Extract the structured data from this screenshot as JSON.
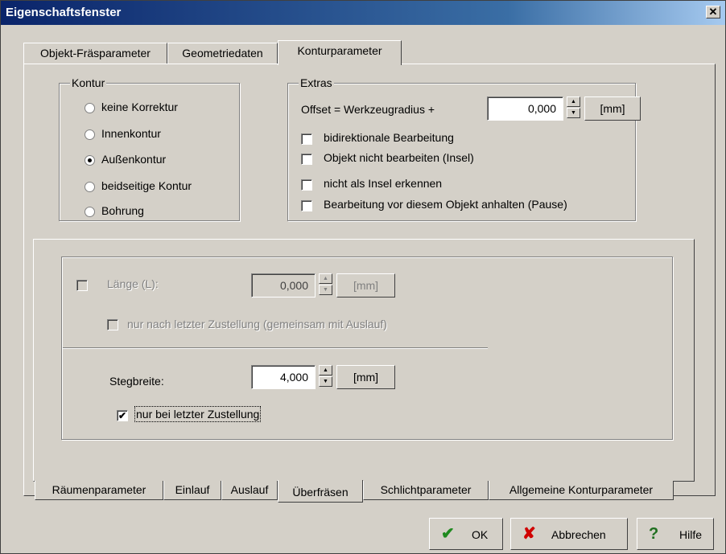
{
  "window": {
    "title": "Eigenschaftsfenster",
    "close_glyph": "✕"
  },
  "top_tabs": [
    {
      "label": "Objekt-Fräsparameter"
    },
    {
      "label": "Geometriedaten"
    },
    {
      "label": "Konturparameter",
      "active": true
    }
  ],
  "kontur": {
    "legend": "Kontur",
    "options": [
      {
        "label": "keine Korrektur",
        "checked": false
      },
      {
        "label": "Innenkontur",
        "checked": false
      },
      {
        "label": "Außenkontur",
        "checked": true
      },
      {
        "label": "beidseitige Kontur",
        "checked": false
      },
      {
        "label": "Bohrung",
        "checked": false
      }
    ]
  },
  "extras": {
    "legend": "Extras",
    "offset_label": "Offset = Werkzeugradius +",
    "offset_value": "0,000",
    "unit": "[mm]",
    "checks": [
      {
        "label": "bidirektionale Bearbeitung",
        "checked": false
      },
      {
        "label": "Objekt nicht bearbeiten (Insel)",
        "checked": false
      },
      {
        "label": "nicht als Insel erkennen",
        "checked": false
      },
      {
        "label": "Bearbeitung vor diesem Objekt anhalten (Pause)",
        "checked": false
      }
    ]
  },
  "ueberfraesen": {
    "laenge_label": "Länge (L):",
    "laenge_value": "0,000",
    "laenge_unit": "[mm]",
    "nur_nach_label": "nur nach letzter Zustellung (gemeinsam mit Auslauf)",
    "stegbreite_label": "Stegbreite:",
    "stegbreite_value": "4,000",
    "stegbreite_unit": "[mm]",
    "nur_bei_label": "nur bei letzter Zustellung",
    "nur_bei_checked": true,
    "check_glyph": "✔"
  },
  "bottom_tabs": [
    {
      "label": "Räumenparameter"
    },
    {
      "label": "Einlauf"
    },
    {
      "label": "Auslauf"
    },
    {
      "label": "Überfräsen",
      "active": true
    },
    {
      "label": "Schlichtparameter"
    },
    {
      "label": "Allgemeine Konturparameter"
    }
  ],
  "buttons": {
    "ok": "OK",
    "ok_icon": "✔",
    "cancel": "Abbrechen",
    "cancel_icon": "✘",
    "help": "Hilfe",
    "help_icon": "?"
  },
  "colors": {
    "ok_icon": "#1f8a1f",
    "cancel_icon": "#d00000",
    "help_icon": "#1f6f1f"
  }
}
